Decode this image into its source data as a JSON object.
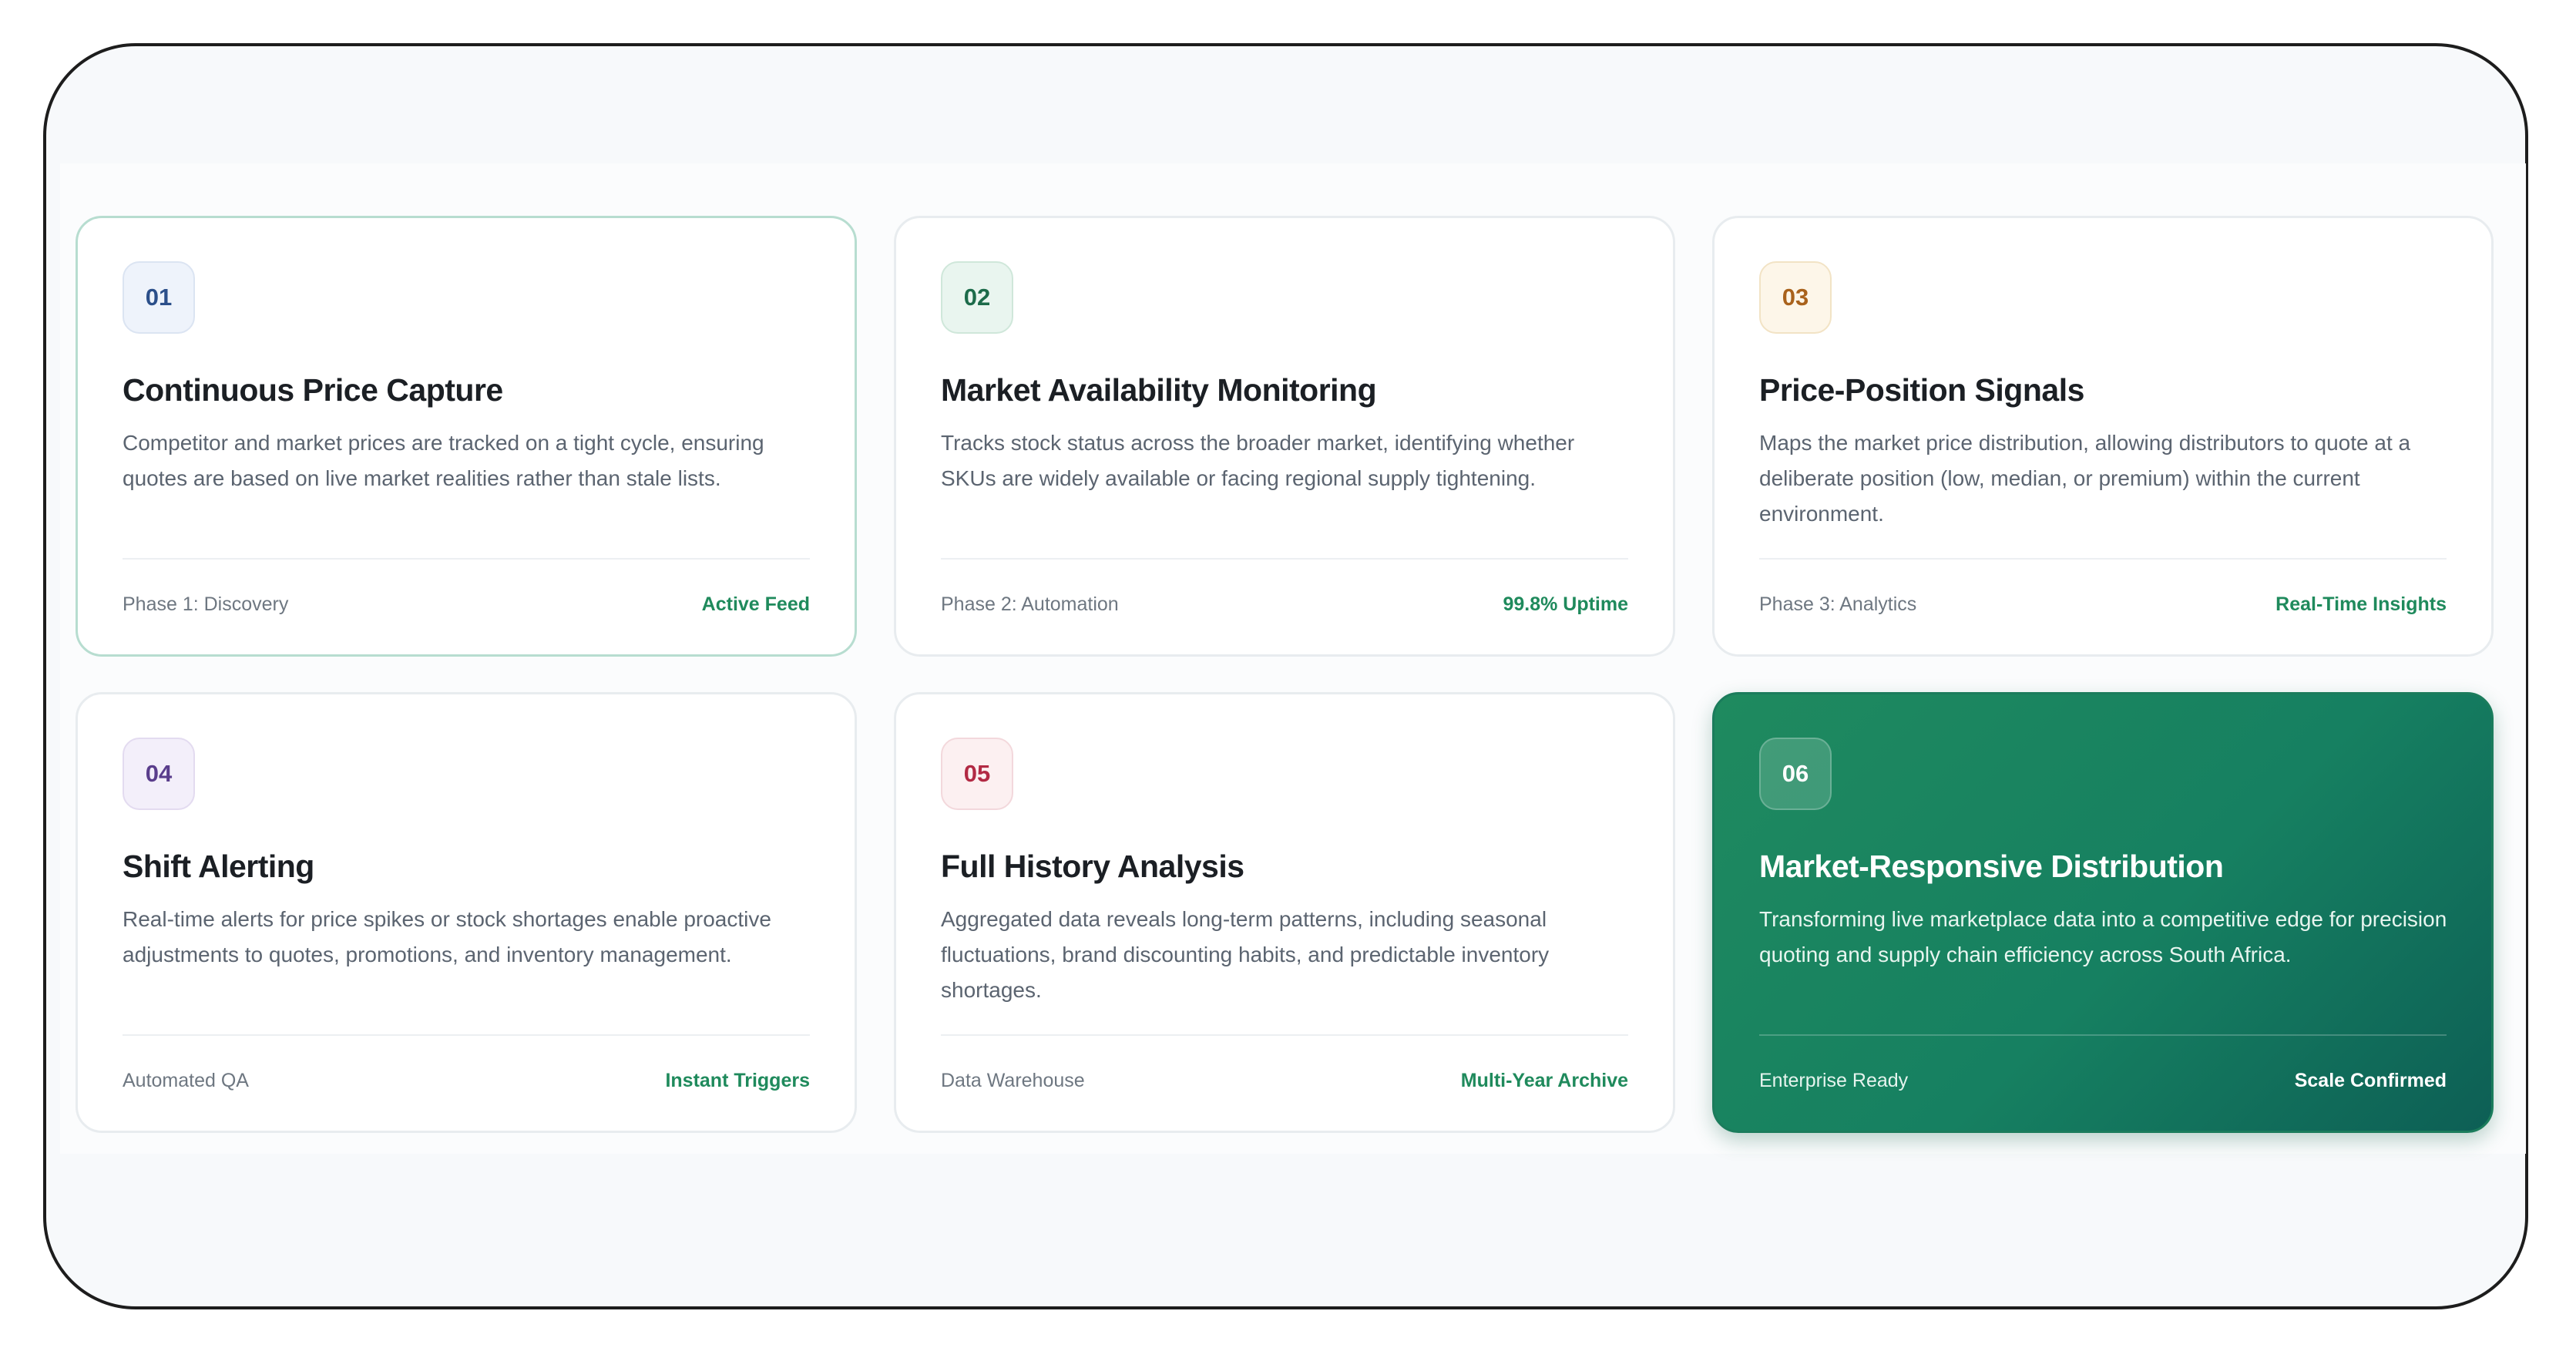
{
  "cards": [
    {
      "number": "01",
      "title": "Continuous Price Capture",
      "description": "Competitor and market prices are tracked on a tight cycle, ensuring quotes are based on live market realities rather than stale lists.",
      "footer_left": "Phase 1: Discovery",
      "footer_right": "Active Feed"
    },
    {
      "number": "02",
      "title": "Market Availability Monitoring",
      "description": "Tracks stock status across the broader market, identifying whether SKUs are widely available or facing regional supply tightening.",
      "footer_left": "Phase 2: Automation",
      "footer_right": "99.8% Uptime"
    },
    {
      "number": "03",
      "title": "Price-Position Signals",
      "description": "Maps the market price distribution, allowing distributors to quote at a deliberate position (low, median, or premium) within the current environment.",
      "footer_left": "Phase 3: Analytics",
      "footer_right": "Real-Time Insights"
    },
    {
      "number": "04",
      "title": "Shift Alerting",
      "description": "Real-time alerts for price spikes or stock shortages enable proactive adjustments to quotes, promotions, and inventory management.",
      "footer_left": "Automated QA",
      "footer_right": "Instant Triggers"
    },
    {
      "number": "05",
      "title": "Full History Analysis",
      "description": "Aggregated data reveals long-term patterns, including seasonal fluctuations, brand discounting habits, and predictable inventory shortages.",
      "footer_left": "Data Warehouse",
      "footer_right": "Multi-Year Archive"
    },
    {
      "number": "06",
      "title": "Market-Responsive Distribution",
      "description": "Transforming live marketplace data into a competitive edge for precision quoting and supply chain efficiency across South Africa.",
      "footer_left": "Enterprise Ready",
      "footer_right": "Scale Confirmed"
    }
  ],
  "colors": {
    "accent_green": "#1f8a5c",
    "featured_gradient_start": "#1f8a5f",
    "featured_gradient_end": "#0d5f55"
  }
}
